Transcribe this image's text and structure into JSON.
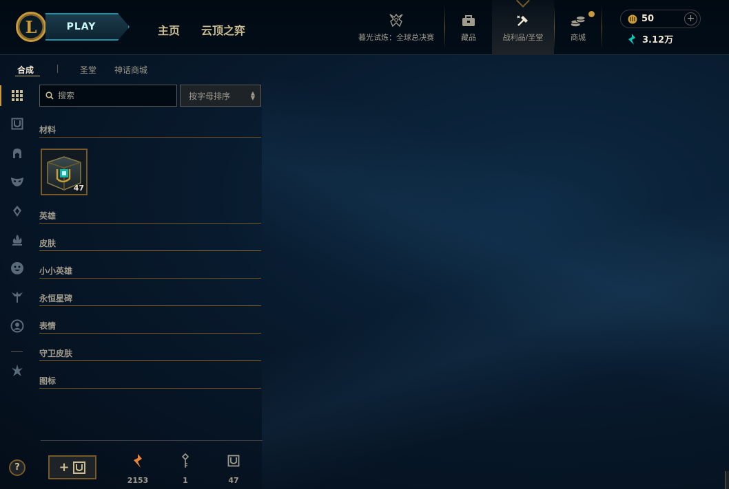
{
  "header": {
    "logo_letter": "L",
    "play_label": "PLAY",
    "nav": [
      {
        "label": "主页"
      },
      {
        "label": "云顶之弈"
      }
    ],
    "icons": [
      {
        "label": "暮光试炼：全球总决赛",
        "icon": "worlds-trophy-icon"
      },
      {
        "label": "藏品",
        "icon": "collection-bag-icon"
      },
      {
        "label": "战利品/圣堂",
        "icon": "loot-hammer-icon"
      },
      {
        "label": "商城",
        "icon": "coins-store-icon"
      }
    ],
    "active_icon": "战利品/圣堂",
    "currency": {
      "rp": "50",
      "plus": "+",
      "blue_essence": "3.12万"
    }
  },
  "subtabs": [
    {
      "label": "合成",
      "active": true
    },
    {
      "label": "圣堂",
      "active": false
    },
    {
      "label": "神话商城",
      "active": false
    }
  ],
  "rail": [
    {
      "icon": "grid-all-icon",
      "active": true
    },
    {
      "icon": "chest-icon"
    },
    {
      "icon": "champion-helmet-icon"
    },
    {
      "icon": "skin-mask-icon"
    },
    {
      "icon": "ward-icon"
    },
    {
      "icon": "emote-flame-icon"
    },
    {
      "icon": "little-legend-face-icon"
    },
    {
      "icon": "eternals-icon"
    },
    {
      "icon": "profile-icon"
    },
    {
      "icon": "tft-companion-icon"
    }
  ],
  "search": {
    "placeholder": "搜索",
    "sort_label": "按字母排序"
  },
  "categories": [
    {
      "label": "材料"
    },
    {
      "label": "英雄"
    },
    {
      "label": "皮肤"
    },
    {
      "label": "小小英雄"
    },
    {
      "label": "永恒星碑"
    },
    {
      "label": "表情"
    },
    {
      "label": "守卫皮肤"
    },
    {
      "label": "图标"
    }
  ],
  "materials": [
    {
      "name": "hextech-chest",
      "count": "47"
    }
  ],
  "footer": {
    "help": "?",
    "add_plus": "+",
    "stats": [
      {
        "icon": "orange-essence-icon",
        "value": "2153"
      },
      {
        "icon": "key-icon",
        "value": "1"
      },
      {
        "icon": "chest-icon",
        "value": "47"
      }
    ]
  },
  "colors": {
    "gold": "#c89b3c",
    "gold_dark": "#785a28",
    "text": "#a09b8c",
    "teal": "#0ac8b9",
    "orange": "#e8843a"
  }
}
